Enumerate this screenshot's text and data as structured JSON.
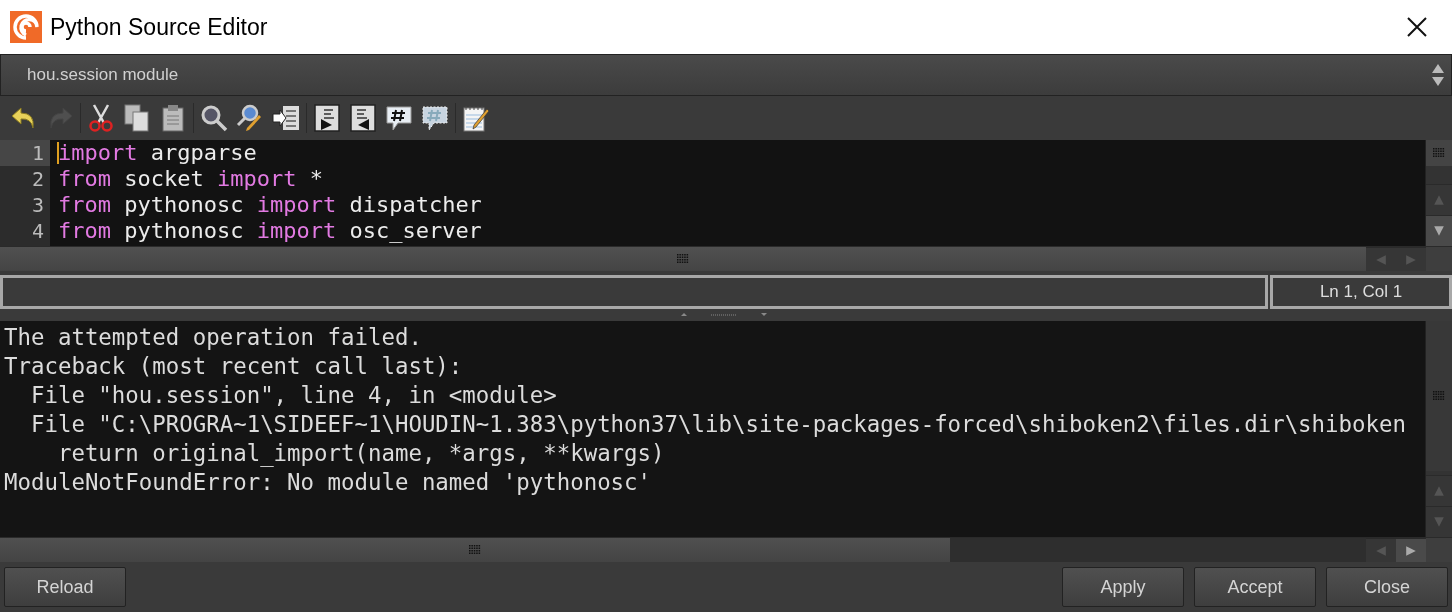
{
  "window": {
    "title": "Python Source Editor"
  },
  "module_selector": {
    "value": "hou.session module"
  },
  "toolbar_groups": [
    {
      "items": [
        {
          "kind": "undo",
          "disabled": false
        },
        {
          "kind": "redo",
          "disabled": true
        }
      ]
    },
    {
      "items": [
        {
          "kind": "cut",
          "disabled": false
        },
        {
          "kind": "copy",
          "disabled": false
        },
        {
          "kind": "paste",
          "disabled": false
        }
      ]
    },
    {
      "items": [
        {
          "kind": "find",
          "disabled": false
        },
        {
          "kind": "replace",
          "disabled": false
        },
        {
          "kind": "goto",
          "disabled": false
        }
      ]
    },
    {
      "items": [
        {
          "kind": "indent",
          "disabled": false
        },
        {
          "kind": "dedent",
          "disabled": false
        },
        {
          "kind": "comment",
          "disabled": false
        },
        {
          "kind": "uncomment",
          "disabled": false
        }
      ]
    },
    {
      "items": [
        {
          "kind": "edit",
          "disabled": false
        }
      ]
    }
  ],
  "editor": {
    "lines": [
      {
        "number": "1",
        "current": true,
        "tokens": [
          {
            "text": "import",
            "kind": "keyword"
          },
          {
            "text": " argparse",
            "kind": "plain"
          }
        ]
      },
      {
        "number": "2",
        "current": false,
        "tokens": [
          {
            "text": "from",
            "kind": "keyword"
          },
          {
            "text": " socket ",
            "kind": "plain"
          },
          {
            "text": "import",
            "kind": "keyword"
          },
          {
            "text": " *",
            "kind": "plain"
          }
        ]
      },
      {
        "number": "3",
        "current": false,
        "tokens": [
          {
            "text": "from",
            "kind": "keyword"
          },
          {
            "text": " pythonosc ",
            "kind": "plain"
          },
          {
            "text": "import",
            "kind": "keyword"
          },
          {
            "text": " dispatcher",
            "kind": "plain"
          }
        ]
      },
      {
        "number": "4",
        "current": false,
        "tokens": [
          {
            "text": "from",
            "kind": "keyword"
          },
          {
            "text": " pythonosc ",
            "kind": "plain"
          },
          {
            "text": "import",
            "kind": "keyword"
          },
          {
            "text": " osc_server",
            "kind": "plain"
          }
        ]
      }
    ]
  },
  "status": {
    "position": "Ln 1, Col 1"
  },
  "output": {
    "lines": [
      "The attempted operation failed.",
      "Traceback (most recent call last):",
      "  File \"hou.session\", line 4, in <module>",
      "  File \"C:\\PROGRA~1\\SIDEEF~1\\HOUDIN~1.383\\python37\\lib\\site-packages-forced\\shiboken2\\files.dir\\shiboken",
      "    return original_import(name, *args, **kwargs)",
      "ModuleNotFoundError: No module named 'pythonosc'"
    ]
  },
  "left_buttons": [
    "Reload"
  ],
  "right_buttons": [
    "Apply",
    "Accept",
    "Close"
  ]
}
